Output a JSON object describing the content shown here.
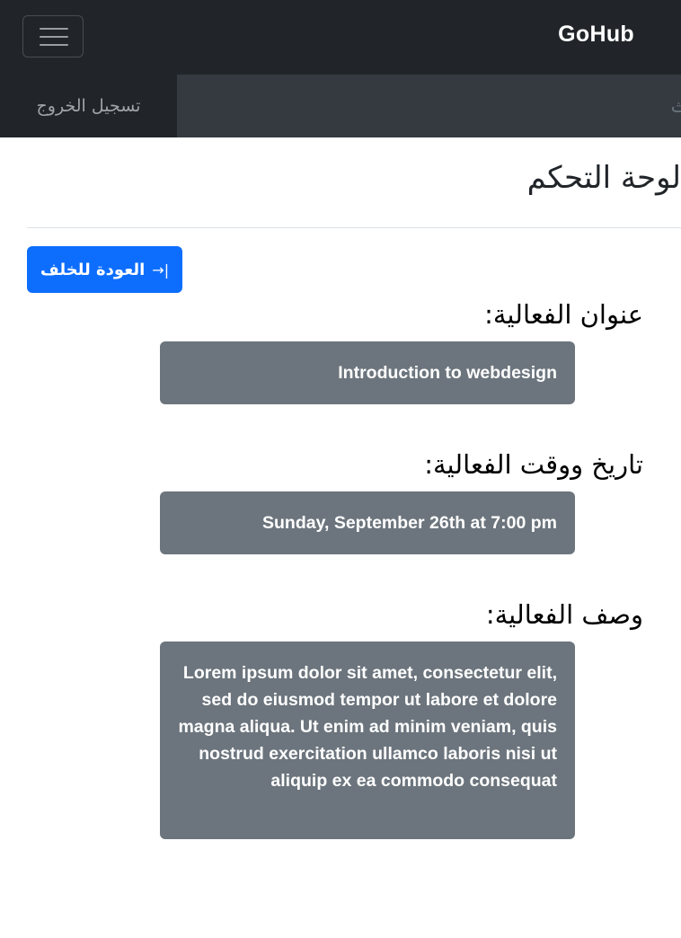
{
  "navbar": {
    "brand": "GoHub",
    "menu_icon": "hamburger-menu-icon"
  },
  "subbar": {
    "search_placeholder": "البحث",
    "logout_label": "تسجيل الخروج"
  },
  "page": {
    "heading": "لوحة التحكم"
  },
  "back_button": {
    "label": "العودة للخلف",
    "icon": "arrow-right-to-bracket-icon",
    "icon_glyph": "|→"
  },
  "event": {
    "title_label": "عنوان الفعالية:",
    "title_value": "Introduction to webdesign",
    "datetime_label": "تاريخ ووقت الفعالية:",
    "datetime_value": "Sunday, September 26th at 7:00 pm",
    "description_label": "وصف الفعالية:",
    "description_value": "Lorem ipsum dolor sit amet, consectetur elit, sed do eiusmod tempor ut labore et dolore magna aliqua. Ut enim ad minim veniam, quis nostrud exercitation ullamco laboris nisi ut aliquip ex ea commodo consequat"
  },
  "colors": {
    "navbar_bg": "#212529",
    "search_bg": "#343a40",
    "primary": "#0d6efd",
    "field_bg": "#6c757d"
  }
}
